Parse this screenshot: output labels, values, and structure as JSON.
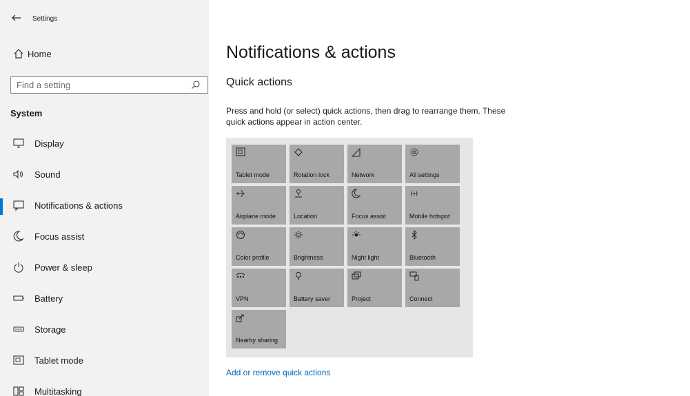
{
  "window": {
    "title": "Settings"
  },
  "sidebar": {
    "home_label": "Home",
    "search": {
      "placeholder": "Find a setting",
      "value": ""
    },
    "section_label": "System",
    "items": [
      {
        "label": "Display",
        "icon": "monitor-icon",
        "selected": false
      },
      {
        "label": "Sound",
        "icon": "speaker-icon",
        "selected": false
      },
      {
        "label": "Notifications & actions",
        "icon": "notifications-icon",
        "selected": true
      },
      {
        "label": "Focus assist",
        "icon": "moon-icon",
        "selected": false
      },
      {
        "label": "Power & sleep",
        "icon": "power-icon",
        "selected": false
      },
      {
        "label": "Battery",
        "icon": "battery-icon",
        "selected": false
      },
      {
        "label": "Storage",
        "icon": "storage-icon",
        "selected": false
      },
      {
        "label": "Tablet mode",
        "icon": "tablet-icon",
        "selected": false
      },
      {
        "label": "Multitasking",
        "icon": "multitasking-icon",
        "selected": false
      }
    ]
  },
  "main": {
    "title": "Notifications & actions",
    "subtitle": "Quick actions",
    "description": "Press and hold (or select) quick actions, then drag to rearrange them. These quick actions appear in action center.",
    "tiles": [
      {
        "label": "Tablet mode",
        "icon": "tablet-mode-icon"
      },
      {
        "label": "Rotation lock",
        "icon": "rotation-lock-icon"
      },
      {
        "label": "Network",
        "icon": "network-icon"
      },
      {
        "label": "All settings",
        "icon": "gear-icon"
      },
      {
        "label": "Airplane mode",
        "icon": "airplane-icon"
      },
      {
        "label": "Location",
        "icon": "location-icon"
      },
      {
        "label": "Focus assist",
        "icon": "moon-icon"
      },
      {
        "label": "Mobile hotspot",
        "icon": "hotspot-icon"
      },
      {
        "label": "Color profile",
        "icon": "color-profile-icon"
      },
      {
        "label": "Brightness",
        "icon": "brightness-icon"
      },
      {
        "label": "Night light",
        "icon": "night-light-icon"
      },
      {
        "label": "Bluetooth",
        "icon": "bluetooth-icon"
      },
      {
        "label": "VPN",
        "icon": "vpn-icon"
      },
      {
        "label": "Battery saver",
        "icon": "battery-saver-icon"
      },
      {
        "label": "Project",
        "icon": "project-icon"
      },
      {
        "label": "Connect",
        "icon": "connect-icon"
      },
      {
        "label": "Nearby sharing",
        "icon": "nearby-sharing-icon"
      }
    ],
    "link_label": "Add or remove quick actions"
  },
  "colors": {
    "accent": "#0078d7",
    "link": "#0066b4",
    "sidebar_bg": "#f2f2f2",
    "panel_bg": "#e6e6e6",
    "tile_bg": "#a8a8a8"
  }
}
